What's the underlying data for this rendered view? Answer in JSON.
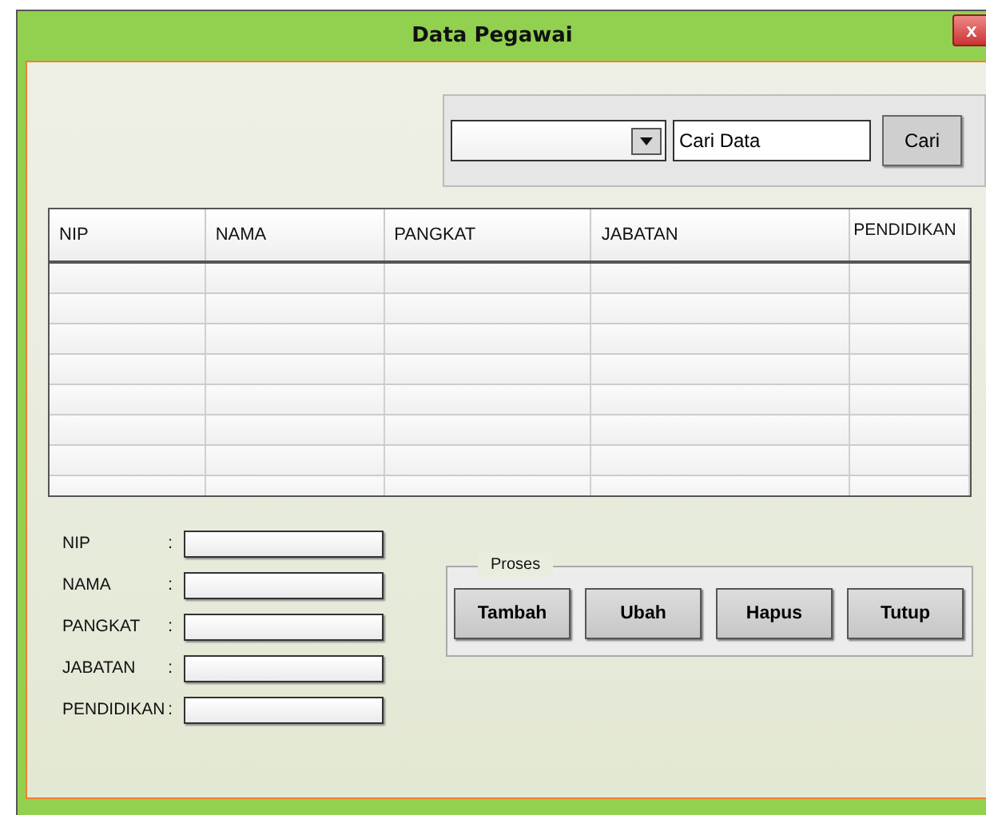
{
  "window": {
    "title": "Data Pegawai",
    "close": "x"
  },
  "search": {
    "value": "Cari Data",
    "button": "Cari"
  },
  "table": {
    "columns": [
      "NIP",
      "NAMA",
      "PANGKAT",
      "JABATAN",
      "PENDIDIKAN"
    ]
  },
  "form": [
    {
      "label": "NIP",
      "sep": ":"
    },
    {
      "label": "NAMA",
      "sep": ":"
    },
    {
      "label": "PANGKAT",
      "sep": ":"
    },
    {
      "label": "JABATAN",
      "sep": ":"
    },
    {
      "label": "PENDIDIKAN",
      "sep": ":"
    }
  ],
  "proses": {
    "legend": "Proses",
    "buttons": [
      "Tambah",
      "Ubah",
      "Hapus",
      "Tutup"
    ]
  }
}
